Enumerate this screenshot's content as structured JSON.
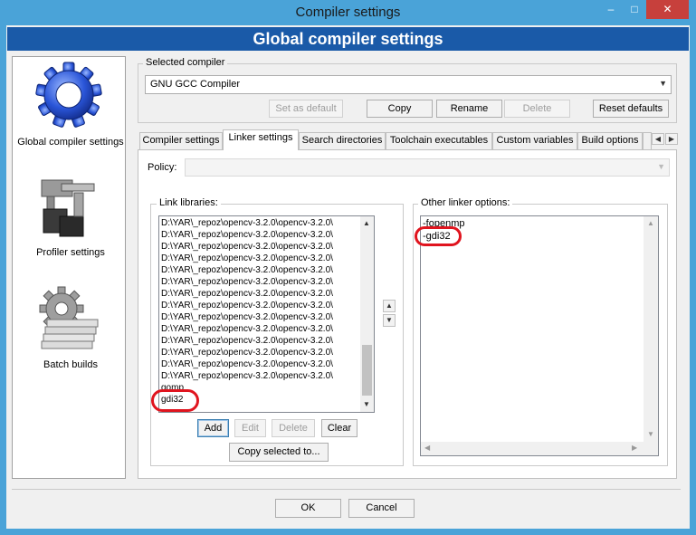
{
  "window": {
    "title": "Compiler settings",
    "minimize_glyph": "–",
    "maximize_glyph": "□",
    "close_glyph": "✕"
  },
  "banner": {
    "title": "Global compiler settings"
  },
  "categories": [
    {
      "label": "Global compiler settings",
      "icon": "gear-icon"
    },
    {
      "label": "Profiler settings",
      "icon": "profiler-icon"
    },
    {
      "label": "Batch builds",
      "icon": "batch-builds-icon"
    }
  ],
  "selected_compiler": {
    "label": "Selected compiler",
    "value": "GNU GCC Compiler",
    "buttons": {
      "set_default": "Set as default",
      "copy": "Copy",
      "rename": "Rename",
      "delete": "Delete",
      "reset": "Reset defaults"
    }
  },
  "tabs": [
    "Compiler settings",
    "Linker settings",
    "Search directories",
    "Toolchain executables",
    "Custom variables",
    "Build options"
  ],
  "policy": {
    "label": "Policy:",
    "value": ""
  },
  "link_libraries": {
    "label": "Link libraries:",
    "items": [
      "D:\\YAR\\_repoz\\opencv-3.2.0\\opencv-3.2.0\\",
      "D:\\YAR\\_repoz\\opencv-3.2.0\\opencv-3.2.0\\",
      "D:\\YAR\\_repoz\\opencv-3.2.0\\opencv-3.2.0\\",
      "D:\\YAR\\_repoz\\opencv-3.2.0\\opencv-3.2.0\\",
      "D:\\YAR\\_repoz\\opencv-3.2.0\\opencv-3.2.0\\",
      "D:\\YAR\\_repoz\\opencv-3.2.0\\opencv-3.2.0\\",
      "D:\\YAR\\_repoz\\opencv-3.2.0\\opencv-3.2.0\\",
      "D:\\YAR\\_repoz\\opencv-3.2.0\\opencv-3.2.0\\",
      "D:\\YAR\\_repoz\\opencv-3.2.0\\opencv-3.2.0\\",
      "D:\\YAR\\_repoz\\opencv-3.2.0\\opencv-3.2.0\\",
      "D:\\YAR\\_repoz\\opencv-3.2.0\\opencv-3.2.0\\",
      "D:\\YAR\\_repoz\\opencv-3.2.0\\opencv-3.2.0\\",
      "D:\\YAR\\_repoz\\opencv-3.2.0\\opencv-3.2.0\\",
      "D:\\YAR\\_repoz\\opencv-3.2.0\\opencv-3.2.0\\",
      "gomp",
      "gdi32"
    ],
    "buttons": {
      "add": "Add",
      "edit": "Edit",
      "delete": "Delete",
      "clear": "Clear",
      "copy_to": "Copy selected to..."
    }
  },
  "other_linker_options": {
    "label": "Other linker options:",
    "lines": [
      "-fopenmp",
      "-gdi32"
    ]
  },
  "dialog_buttons": {
    "ok": "OK",
    "cancel": "Cancel"
  },
  "colors": {
    "banner": "#1a5aa8",
    "titlebar": "#4aa3d8",
    "close_button": "#c7403c",
    "highlight_circle": "#e0141e"
  }
}
